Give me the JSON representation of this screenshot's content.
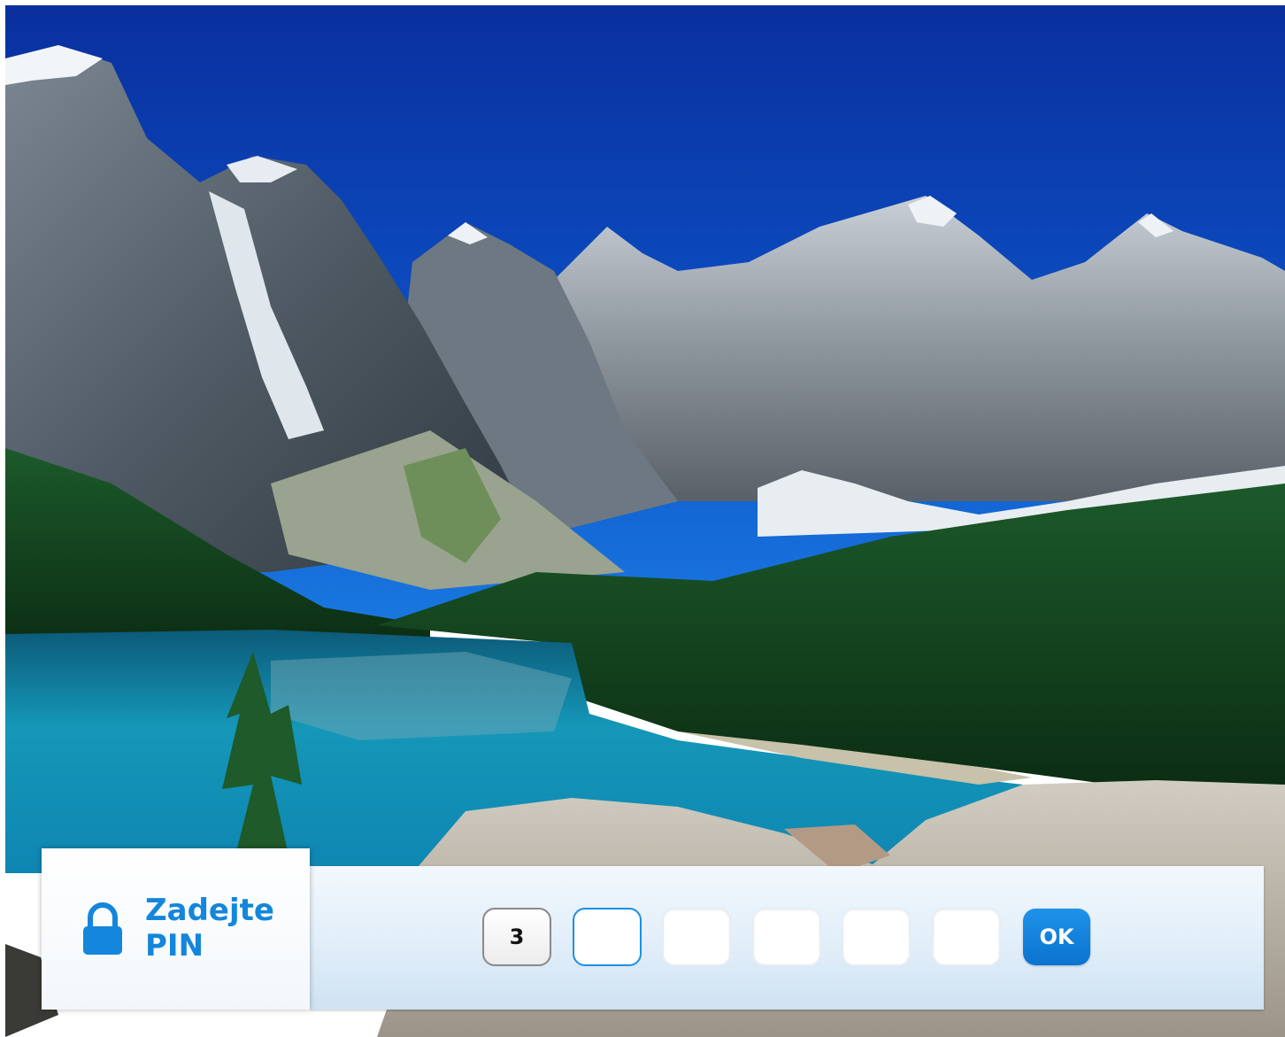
{
  "pin_panel": {
    "title": "Zadejte PIN",
    "icon": "lock-icon",
    "digits": [
      "3",
      "",
      "",
      "",
      "",
      ""
    ],
    "active_index": 1,
    "ok_label": "OK",
    "accent_color": "#1486db"
  },
  "background": {
    "scene": "mountain-lake-wallpaper"
  }
}
